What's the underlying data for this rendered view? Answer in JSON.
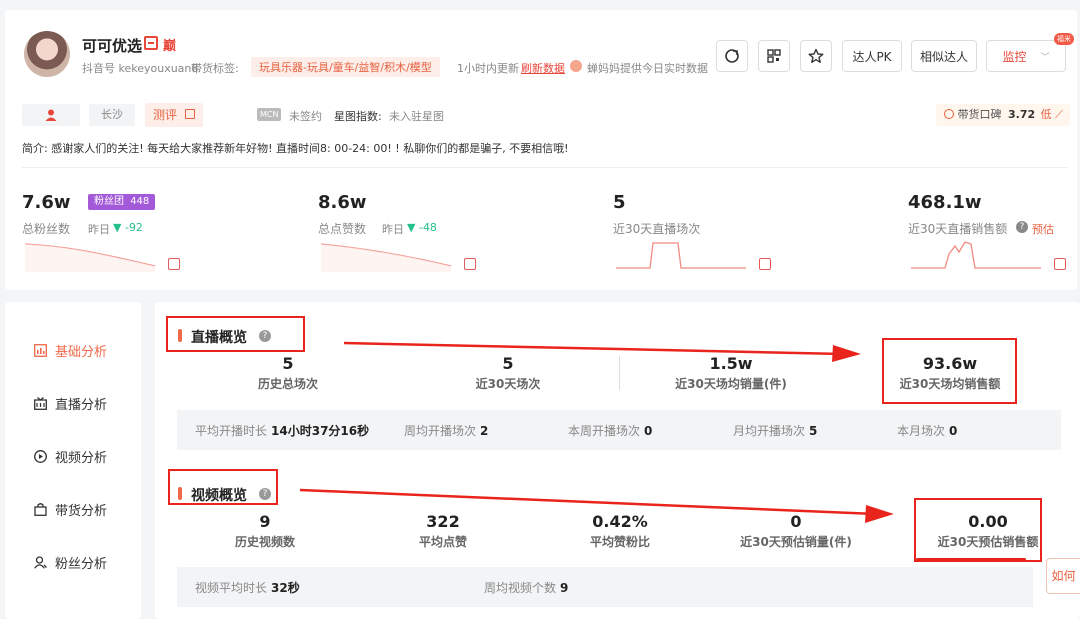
{
  "profile": {
    "name": "可可优选",
    "badge_a": "巅",
    "account_label": "抖音号 kekeyouxuan8",
    "tag_label": "带货标签:",
    "tag_value": "玩具乐器-玩具/童车/益智/积木/模型",
    "update_text": "1小时内更新",
    "refresh_link": "刷新数据",
    "provider_text": "蝉妈妈提供今日实时数据"
  },
  "toolbar": {
    "pk_label": "达人PK",
    "similar_label": "相似达人",
    "monitor_label": "监控",
    "monitor_badge": "福米"
  },
  "info": {
    "city": "长沙",
    "review_label": "测评",
    "mcn_tag": "MCN",
    "mcn_value": "未签约",
    "star_label": "星图指数:",
    "star_value": "未入驻星图",
    "koubei_label": "带货口碑",
    "koubei_value": "3.72",
    "koubei_level": "低",
    "intro": "简介:  感谢家人们的关注!  每天给大家推荐新年好物!  直播时间8:  00-24:  00!  !  私聊你们的都是骗子,  不要相信哦!"
  },
  "stats": [
    {
      "value": "7.6w",
      "label": "总粉丝数",
      "yesterday": "昨日",
      "delta": "-92",
      "fan_badge": "粉丝团",
      "fan_count": "448"
    },
    {
      "value": "8.6w",
      "label": "总点赞数",
      "yesterday": "昨日",
      "delta": "-48"
    },
    {
      "value": "5",
      "label": "近30天直播场次"
    },
    {
      "value": "468.1w",
      "label": "近30天直播销售额",
      "extra": "预估"
    }
  ],
  "nav": [
    {
      "label": "基础分析",
      "icon": "chart-icon"
    },
    {
      "label": "直播分析",
      "icon": "live-icon"
    },
    {
      "label": "视频分析",
      "icon": "play-icon"
    },
    {
      "label": "带货分析",
      "icon": "bag-icon"
    },
    {
      "label": "粉丝分析",
      "icon": "user-icon"
    }
  ],
  "live": {
    "title": "直播概览",
    "metrics": [
      {
        "value": "5",
        "label": "历史总场次"
      },
      {
        "value": "5",
        "label": "近30天场次"
      },
      {
        "value": "1.5w",
        "label": "近30天场均销量(件)"
      },
      {
        "value": "93.6w",
        "label": "近30天场均销售额"
      }
    ],
    "sub": [
      {
        "label": "平均开播时长",
        "value": "14小时37分16秒"
      },
      {
        "label": "周均开播场次",
        "value": "2"
      },
      {
        "label": "本周开播场次",
        "value": "0"
      },
      {
        "label": "月均开播场次",
        "value": "5"
      },
      {
        "label": "本月场次",
        "value": "0"
      }
    ]
  },
  "video": {
    "title": "视频概览",
    "metrics": [
      {
        "value": "9",
        "label": "历史视频数"
      },
      {
        "value": "322",
        "label": "平均点赞"
      },
      {
        "value": "0.42%",
        "label": "平均赞粉比"
      },
      {
        "value": "0",
        "label": "近30天预估销量(件)"
      },
      {
        "value": "0.00",
        "label": "近30天预估销售额"
      }
    ],
    "sub": [
      {
        "label": "视频平均时长",
        "value": "32秒"
      },
      {
        "label": "周均视频个数",
        "value": "9"
      }
    ]
  },
  "float_btn": "如何"
}
